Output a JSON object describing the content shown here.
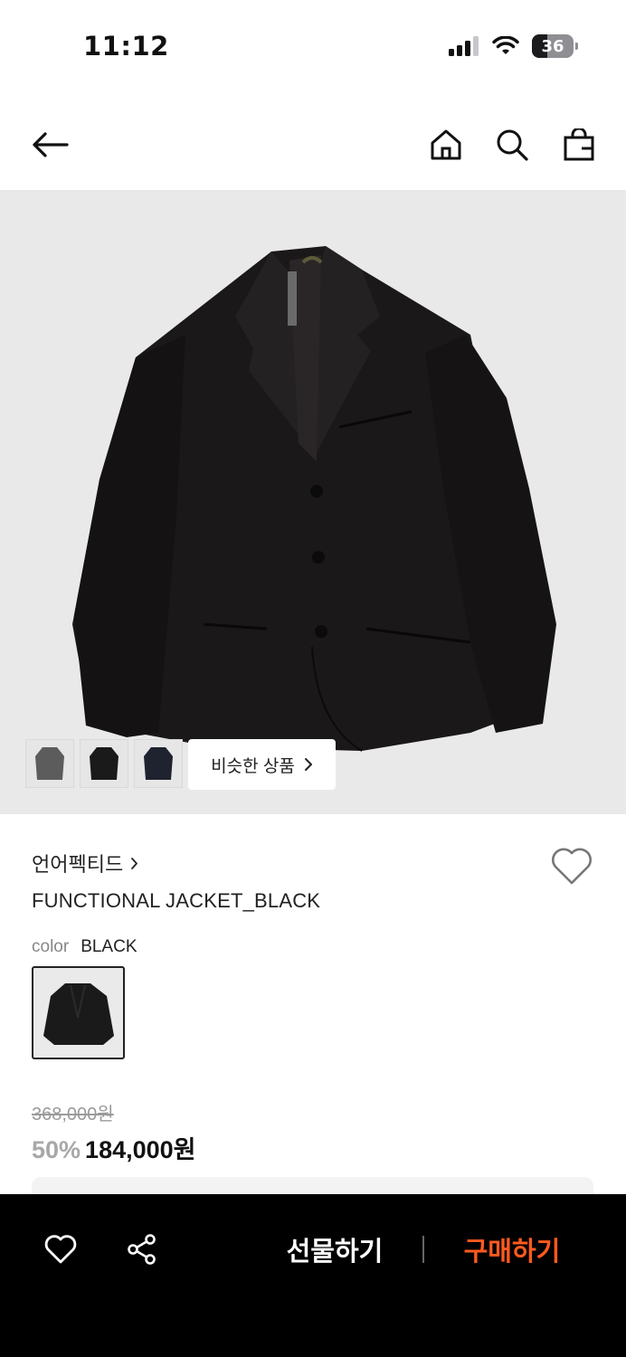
{
  "status_bar": {
    "time": "11:12",
    "battery": "36"
  },
  "icons": {
    "back": "arrow-left-icon",
    "home": "home-icon",
    "search": "search-icon",
    "cart": "shopping-bag-icon",
    "wishlist": "heart-icon",
    "share": "share-icon",
    "chevron": "chevron-right-icon"
  },
  "gallery": {
    "similar_label": "비슷한 상품",
    "thumbnail_count": 3
  },
  "product": {
    "brand": "언어펙티드",
    "name": "FUNCTIONAL JACKET_BLACK",
    "color_label": "color",
    "color_value": "BLACK",
    "original_price": "368,000원",
    "discount": "50%",
    "sale_price": "184,000원"
  },
  "actions": {
    "gift_label": "선물하기",
    "buy_label": "구매하기"
  },
  "colors": {
    "accent": "#ff5a1f",
    "bottom_bar": "#000000",
    "hero_bg": "#e9e9e9"
  }
}
